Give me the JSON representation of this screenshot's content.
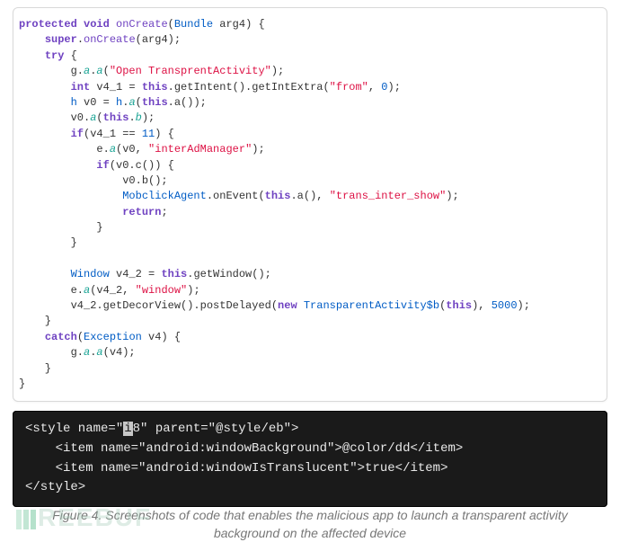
{
  "top_code": {
    "lines": [
      [
        {
          "cls": "kw",
          "t": "protected"
        },
        {
          "t": " "
        },
        {
          "cls": "kw",
          "t": "void"
        },
        {
          "t": " "
        },
        {
          "cls": "id",
          "t": "onCreate"
        },
        {
          "t": "("
        },
        {
          "cls": "cls",
          "t": "Bundle"
        },
        {
          "t": " arg4) {"
        }
      ],
      [
        {
          "t": "    "
        },
        {
          "cls": "kw",
          "t": "super"
        },
        {
          "t": "."
        },
        {
          "cls": "id",
          "t": "onCreate"
        },
        {
          "t": "(arg4);"
        }
      ],
      [
        {
          "t": "    "
        },
        {
          "cls": "kw",
          "t": "try"
        },
        {
          "t": " {"
        }
      ],
      [
        {
          "t": "        g."
        },
        {
          "cls": "teal",
          "t": "a"
        },
        {
          "t": "."
        },
        {
          "cls": "teal",
          "t": "a"
        },
        {
          "t": "("
        },
        {
          "cls": "str",
          "t": "\"Open TransprentActivity\""
        },
        {
          "t": ");"
        }
      ],
      [
        {
          "t": "        "
        },
        {
          "cls": "kw",
          "t": "int"
        },
        {
          "t": " v4_1 = "
        },
        {
          "cls": "kw",
          "t": "this"
        },
        {
          "t": ".getIntent().getIntExtra("
        },
        {
          "cls": "str",
          "t": "\"from\""
        },
        {
          "t": ", "
        },
        {
          "cls": "num",
          "t": "0"
        },
        {
          "t": ");"
        }
      ],
      [
        {
          "t": "        "
        },
        {
          "cls": "cls",
          "t": "h"
        },
        {
          "t": " v0 = "
        },
        {
          "cls": "cls",
          "t": "h"
        },
        {
          "t": "."
        },
        {
          "cls": "teal",
          "t": "a"
        },
        {
          "t": "("
        },
        {
          "cls": "kw",
          "t": "this"
        },
        {
          "t": ".a());"
        }
      ],
      [
        {
          "t": "        v0."
        },
        {
          "cls": "teal",
          "t": "a"
        },
        {
          "t": "("
        },
        {
          "cls": "kw",
          "t": "this"
        },
        {
          "t": "."
        },
        {
          "cls": "teal",
          "t": "b"
        },
        {
          "t": ");"
        }
      ],
      [
        {
          "t": "        "
        },
        {
          "cls": "kw",
          "t": "if"
        },
        {
          "t": "(v4_1 == "
        },
        {
          "cls": "num",
          "t": "11"
        },
        {
          "t": ") {"
        }
      ],
      [
        {
          "t": "            e."
        },
        {
          "cls": "teal",
          "t": "a"
        },
        {
          "t": "(v0, "
        },
        {
          "cls": "str",
          "t": "\"interAdManager\""
        },
        {
          "t": ");"
        }
      ],
      [
        {
          "t": "            "
        },
        {
          "cls": "kw",
          "t": "if"
        },
        {
          "t": "(v0.c()) {"
        }
      ],
      [
        {
          "t": "                v0.b();"
        }
      ],
      [
        {
          "t": "                "
        },
        {
          "cls": "cls",
          "t": "MobclickAgent"
        },
        {
          "t": ".onEvent("
        },
        {
          "cls": "kw",
          "t": "this"
        },
        {
          "t": ".a(), "
        },
        {
          "cls": "str",
          "t": "\"trans_inter_show\""
        },
        {
          "t": ");"
        }
      ],
      [
        {
          "t": "                "
        },
        {
          "cls": "kw",
          "t": "return"
        },
        {
          "t": ";"
        }
      ],
      [
        {
          "t": "            }"
        }
      ],
      [
        {
          "t": "        }"
        }
      ],
      [
        {
          "t": ""
        }
      ],
      [
        {
          "t": "        "
        },
        {
          "cls": "cls",
          "t": "Window"
        },
        {
          "t": " v4_2 = "
        },
        {
          "cls": "kw",
          "t": "this"
        },
        {
          "t": ".getWindow();"
        }
      ],
      [
        {
          "t": "        e."
        },
        {
          "cls": "teal",
          "t": "a"
        },
        {
          "t": "(v4_2, "
        },
        {
          "cls": "str",
          "t": "\"window\""
        },
        {
          "t": ");"
        }
      ],
      [
        {
          "t": "        v4_2.getDecorView().postDelayed("
        },
        {
          "cls": "kw",
          "t": "new"
        },
        {
          "t": " "
        },
        {
          "cls": "cls",
          "t": "TransparentActivity$b"
        },
        {
          "t": "("
        },
        {
          "cls": "kw",
          "t": "this"
        },
        {
          "t": "), "
        },
        {
          "cls": "num",
          "t": "5000"
        },
        {
          "t": ");"
        }
      ],
      [
        {
          "t": "    }"
        }
      ],
      [
        {
          "t": "    "
        },
        {
          "cls": "kw",
          "t": "catch"
        },
        {
          "t": "("
        },
        {
          "cls": "cls",
          "t": "Exception"
        },
        {
          "t": " v4) {"
        }
      ],
      [
        {
          "t": "        g."
        },
        {
          "cls": "teal",
          "t": "a"
        },
        {
          "t": "."
        },
        {
          "cls": "teal",
          "t": "a"
        },
        {
          "t": "(v4);"
        }
      ],
      [
        {
          "t": "    }"
        }
      ],
      [
        {
          "t": "}"
        }
      ]
    ]
  },
  "xml_code": {
    "lines": [
      "<style name=\"§i§8\" parent=\"@style/eb\">",
      "    <item name=\"android:windowBackground\">@color/dd</item>",
      "    <item name=\"android:windowIsTranslucent\">true</item>",
      "</style>"
    ]
  },
  "caption": "Figure 4. Screenshots of code that enables the malicious app to launch a transparent activity background on the affected device",
  "watermark_text": "REEBUF"
}
